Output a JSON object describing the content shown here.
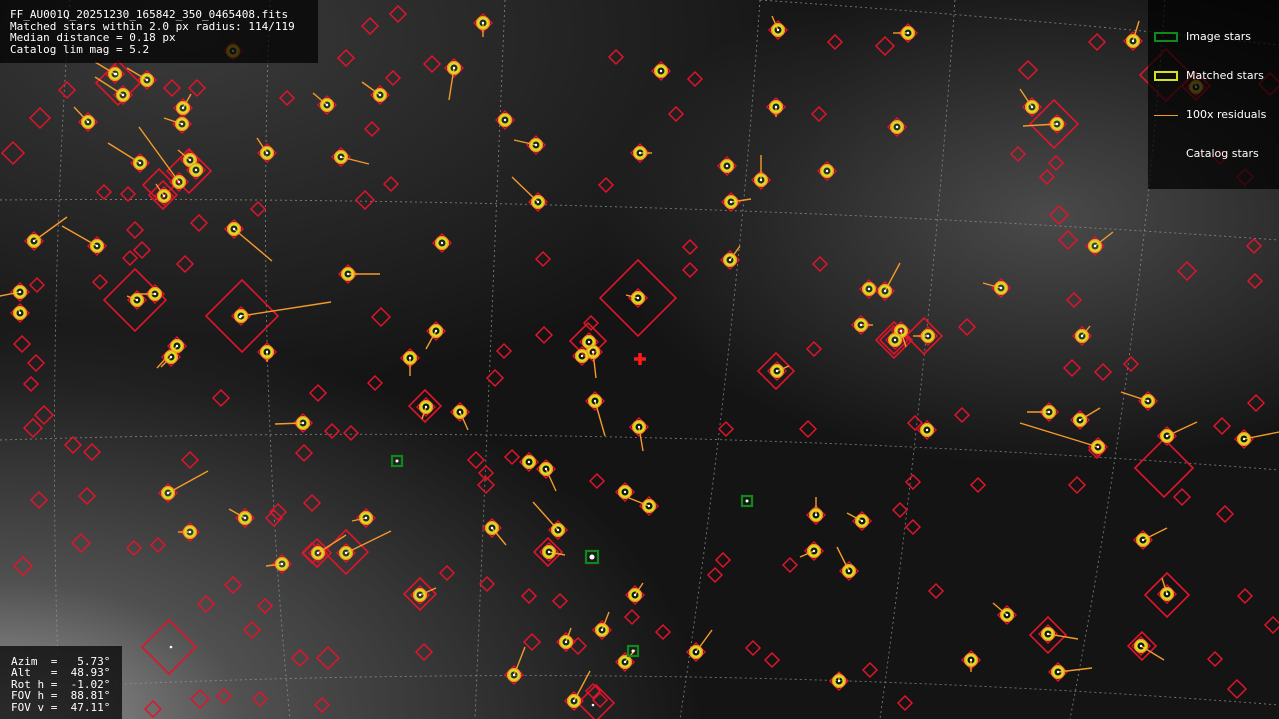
{
  "info": {
    "filename": "FF_AU001Q_20251230_165842_350_0465408.fits",
    "matched_line": "Matched stars within 2.0 px radius: 114/119",
    "median_line": "Median distance = 0.18 px",
    "limmag_line": "Catalog lim mag = 5.2"
  },
  "pointing": {
    "azim": "Azim  =   5.73°",
    "alt": "Alt   =  48.93°",
    "roth": "Rot h =  -1.02°",
    "fovh": "FOV h =  88.81°",
    "fovv": "FOV v =  47.11°"
  },
  "legend": {
    "image_stars": "Image stars",
    "matched_stars": "Matched stars",
    "residuals": "100x residuals",
    "catalog_stars": "Catalog stars"
  },
  "colors": {
    "catalog": "#e0142a",
    "matched": "#d7e01e",
    "residual": "#f59a2a",
    "image_star": "#0f8a1a",
    "grid": "#9a9a9a",
    "center_marker": "#ff1a1a"
  },
  "icons": {
    "center": "red-plus-icon"
  }
}
